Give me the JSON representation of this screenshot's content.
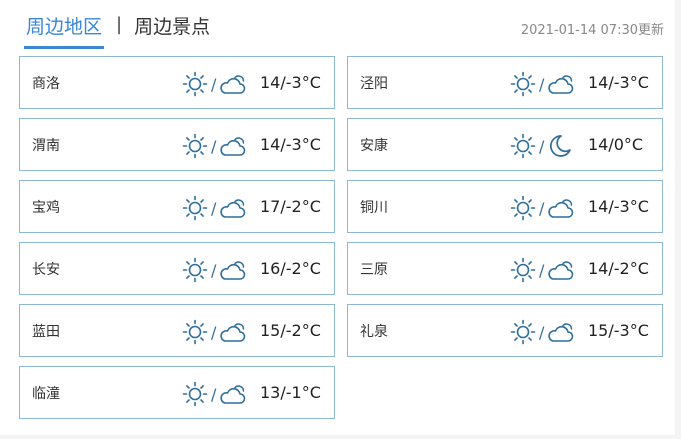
{
  "tabs": {
    "active": "周边地区",
    "separator": "|",
    "other": "周边景点"
  },
  "update_time": "2021-01-14 07:30更新",
  "colors": {
    "accent": "#3a87d6",
    "icon": "#2f6e9a",
    "border": "#8eb8d6"
  },
  "cities": [
    {
      "name": "商洛",
      "day_icon": "sunny-icon",
      "night_icon": "cloudy-icon",
      "temp": "14/-3°C"
    },
    {
      "name": "泾阳",
      "day_icon": "sunny-icon",
      "night_icon": "cloudy-icon",
      "temp": "14/-3°C"
    },
    {
      "name": "渭南",
      "day_icon": "sunny-icon",
      "night_icon": "cloudy-icon",
      "temp": "14/-3°C"
    },
    {
      "name": "安康",
      "day_icon": "sunny-icon",
      "night_icon": "moon-icon",
      "temp": "14/0°C"
    },
    {
      "name": "宝鸡",
      "day_icon": "sunny-icon",
      "night_icon": "cloudy-icon",
      "temp": "17/-2°C"
    },
    {
      "name": "铜川",
      "day_icon": "sunny-icon",
      "night_icon": "cloudy-icon",
      "temp": "14/-3°C"
    },
    {
      "name": "长安",
      "day_icon": "sunny-icon",
      "night_icon": "cloudy-icon",
      "temp": "16/-2°C"
    },
    {
      "name": "三原",
      "day_icon": "sunny-icon",
      "night_icon": "cloudy-icon",
      "temp": "14/-2°C"
    },
    {
      "name": "蓝田",
      "day_icon": "sunny-icon",
      "night_icon": "cloudy-icon",
      "temp": "15/-2°C"
    },
    {
      "name": "礼泉",
      "day_icon": "sunny-icon",
      "night_icon": "cloudy-icon",
      "temp": "15/-3°C"
    },
    {
      "name": "临潼",
      "day_icon": "sunny-icon",
      "night_icon": "cloudy-icon",
      "temp": "13/-1°C"
    }
  ]
}
